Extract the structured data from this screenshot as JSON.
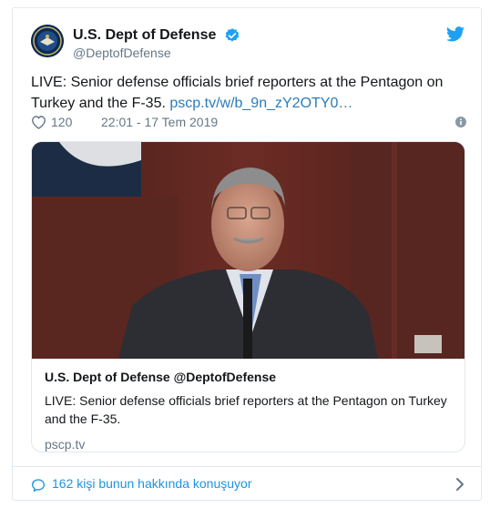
{
  "account": {
    "display_name": "U.S. Dept of Defense",
    "handle": "@DeptofDefense"
  },
  "tweet": {
    "text": "LIVE: Senior defense officials brief reporters at the Pentagon on Turkey and the F-35.",
    "link": "pscp.tv/w/b_9n_zY2OTY0…",
    "like_count": "120",
    "timestamp": "22:01 - 17 Tem 2019"
  },
  "card": {
    "title": "U.S. Dept of Defense @DeptofDefense",
    "description": "LIVE: Senior defense officials brief reporters at the Pentagon on Turkey and the F-35.",
    "domain": "pscp.tv"
  },
  "footer": {
    "conversation_text": "162 kişi bunun hakkında konuşuyor"
  },
  "colors": {
    "link": "#2b7bb9",
    "twitter_blue": "#1da1f2",
    "secondary_text": "#657786",
    "border": "#e1e8ed"
  },
  "icons": [
    "dod-seal-avatar",
    "verified-icon",
    "twitter-logo-icon",
    "heart-icon",
    "info-icon",
    "chat-bubble-icon",
    "chevron-right-icon"
  ]
}
